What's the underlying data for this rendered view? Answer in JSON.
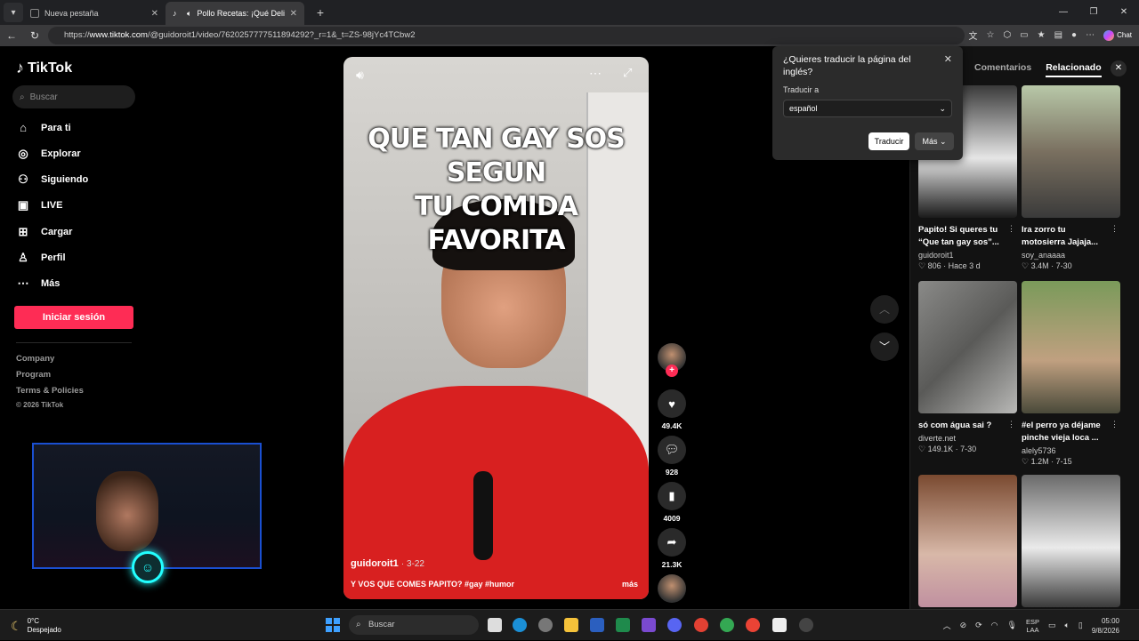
{
  "browser": {
    "tabs": [
      {
        "title": "Nueva pestaña",
        "active": false
      },
      {
        "title": "Pollo Recetas: ¡Qué Delicia, Pa",
        "active": true
      }
    ],
    "new_tab": "+",
    "url_prefix": "https://",
    "url_host": "www.tiktok.com",
    "url_path": "/@guidoroit1/video/7620257777511894292?_r=1&_t=ZS-98jYc4TCbw2",
    "chat_label": "Chat"
  },
  "sidebar": {
    "logo": "TikTok",
    "search_placeholder": "Buscar",
    "nav": [
      {
        "label": "Para ti",
        "icon": "home-icon"
      },
      {
        "label": "Explorar",
        "icon": "compass-icon"
      },
      {
        "label": "Siguiendo",
        "icon": "following-icon"
      },
      {
        "label": "LIVE",
        "icon": "live-icon"
      },
      {
        "label": "Cargar",
        "icon": "upload-icon"
      },
      {
        "label": "Perfil",
        "icon": "profile-icon"
      },
      {
        "label": "Más",
        "icon": "more-icon"
      }
    ],
    "login_label": "Iniciar sesión",
    "footer": [
      "Company",
      "Program",
      "Terms & Policies"
    ],
    "copyright": "© 2026 TikTok"
  },
  "video": {
    "overlay_line1": "QUE TAN GAY SOS SEGUN",
    "overlay_line2": "TU COMIDA FAVORITA",
    "author": "guidoroit1",
    "date": "· 3-22",
    "caption": "Y VOS QUE COMES PAPITO? #gay #humor",
    "more": "más"
  },
  "actions": {
    "likes": "49.4K",
    "comments": "928",
    "saves": "4009",
    "shares": "21.3K"
  },
  "rightpane": {
    "tab_comments": "Comentarios",
    "tab_related": "Relacionado",
    "cards": [
      {
        "title": "Papito! Si queres tu “Que tan gay sos”...",
        "author": "guidoroit1",
        "stats": "806 · Hace 3 d",
        "colors": [
          "#1a1a1a",
          "#d0d0d0"
        ]
      },
      {
        "title": "Ira zorro tu motosierra Jajaja...",
        "author": "soy_anaaaa",
        "stats": "3.4M · 7-30",
        "colors": [
          "#8aa080",
          "#3a3a3a"
        ]
      },
      {
        "title": "só com água sai ?",
        "author": "diverte.net",
        "stats": "149.1K · 7-30",
        "colors": [
          "#7a7a78",
          "#b0b0ae"
        ]
      },
      {
        "title": "#el perro ya déjame pinche vieja loca ...",
        "author": "alely5736",
        "stats": "1.2M · 7-15",
        "colors": [
          "#6a8a4a",
          "#c0a080"
        ]
      },
      {
        "title": "",
        "author": "",
        "stats": "",
        "colors": [
          "#6a3a28",
          "#d0b0a0"
        ]
      },
      {
        "title": "",
        "author": "",
        "stats": "",
        "colors": [
          "#505050",
          "#e0e0e0"
        ]
      }
    ]
  },
  "translate": {
    "title": "¿Quieres traducir la página del inglés?",
    "label": "Traducir a",
    "selected": "español",
    "translate_btn": "Traducir",
    "more_btn": "Más"
  },
  "taskbar": {
    "temp": "0°C",
    "weather": "Despejado",
    "search": "Buscar",
    "lang1": "ESP",
    "lang2": "LAA",
    "time": "05:00",
    "date": "9/8/2026"
  }
}
